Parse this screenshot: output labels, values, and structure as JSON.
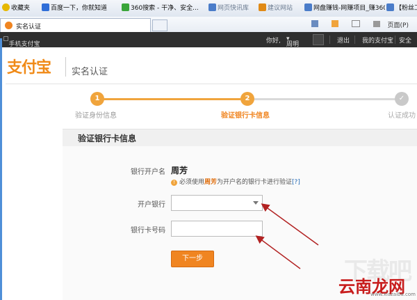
{
  "browser": {
    "favorites": [
      {
        "label": "收藏夹",
        "icon": "star-icon",
        "color": "#e6b800"
      },
      {
        "label": "百度一下，你就知道",
        "icon": "baidu-icon",
        "color": "#2f6ed8"
      },
      {
        "label": "360搜索 - 干净、安全...",
        "icon": "360-icon",
        "color": "#3aa53a"
      },
      {
        "label": "网页快讯库",
        "icon": "feed-icon",
        "color": "#4a7cc9"
      },
      {
        "label": "建议网站",
        "icon": "suggest-icon",
        "color": "#e08a16"
      },
      {
        "label": "网盘赚钱-网赚项目_赚360",
        "icon": "page-icon",
        "color": "#4a7cc9"
      },
      {
        "label": "【粉丝工",
        "icon": "page-icon",
        "color": "#4a7cc9"
      }
    ],
    "tab_title": "实名认证",
    "tools": {
      "page_menu": "页面(P)"
    }
  },
  "site_bar": {
    "left_link": "手机支付宝",
    "greeting": "你好,",
    "user": "周明",
    "logout": "退出",
    "my_alipay": "我的支付宝",
    "security": "安全"
  },
  "header": {
    "logo_text": "支付宝",
    "page_title": "实名认证"
  },
  "steps": [
    {
      "num": "1",
      "label": "验证身份信息",
      "state": "done"
    },
    {
      "num": "2",
      "label": "验证银行卡信息",
      "state": "active"
    },
    {
      "num": "✓",
      "label": "认证成功",
      "state": "pending"
    }
  ],
  "form": {
    "section_title": "验证银行卡信息",
    "holder_label": "银行开户名",
    "holder_value": "周芳",
    "notice_pre": "必须使用",
    "notice_name": "周芳",
    "notice_post": "为开户名的银行卡进行验证",
    "notice_help": "[?]",
    "bank_label": "开户银行",
    "bank_value": "",
    "card_label": "银行卡号码",
    "card_value": "",
    "next_button": "下一步"
  },
  "watermark": {
    "line1": "下载吧",
    "line2": "云南龙网",
    "line3": "www.xiazaiba.com"
  },
  "colors": {
    "accent": "#f08521",
    "step_done": "#f0a43c",
    "step_pending": "#cccccc",
    "arrow": "#b22222"
  }
}
